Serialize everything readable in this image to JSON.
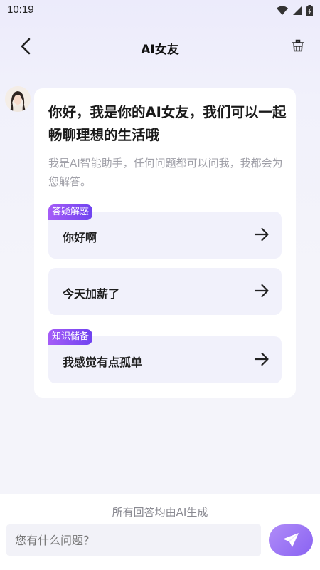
{
  "status_bar": {
    "time": "10:19"
  },
  "header": {
    "title": "AI女友"
  },
  "greeting": {
    "title": "你好，我是你的AI女友，我们可以一起畅聊理想的生活哦",
    "subtitle": "我是AI智能助手，任何问题都可以问我，我都会为您解答。"
  },
  "suggestions": [
    {
      "tag": "答疑解惑",
      "text": "你好啊"
    },
    {
      "tag": "",
      "text": "今天加薪了"
    },
    {
      "tag": "知识储备",
      "text": "我感觉有点孤单"
    }
  ],
  "footer": {
    "disclaimer": "所有回答均由AI生成",
    "input_placeholder": "您有什么问题？"
  },
  "colors": {
    "accent": "#8a63f2",
    "tag_gradient_start": "#a55cf7",
    "tag_gradient_end": "#6f43f0"
  }
}
